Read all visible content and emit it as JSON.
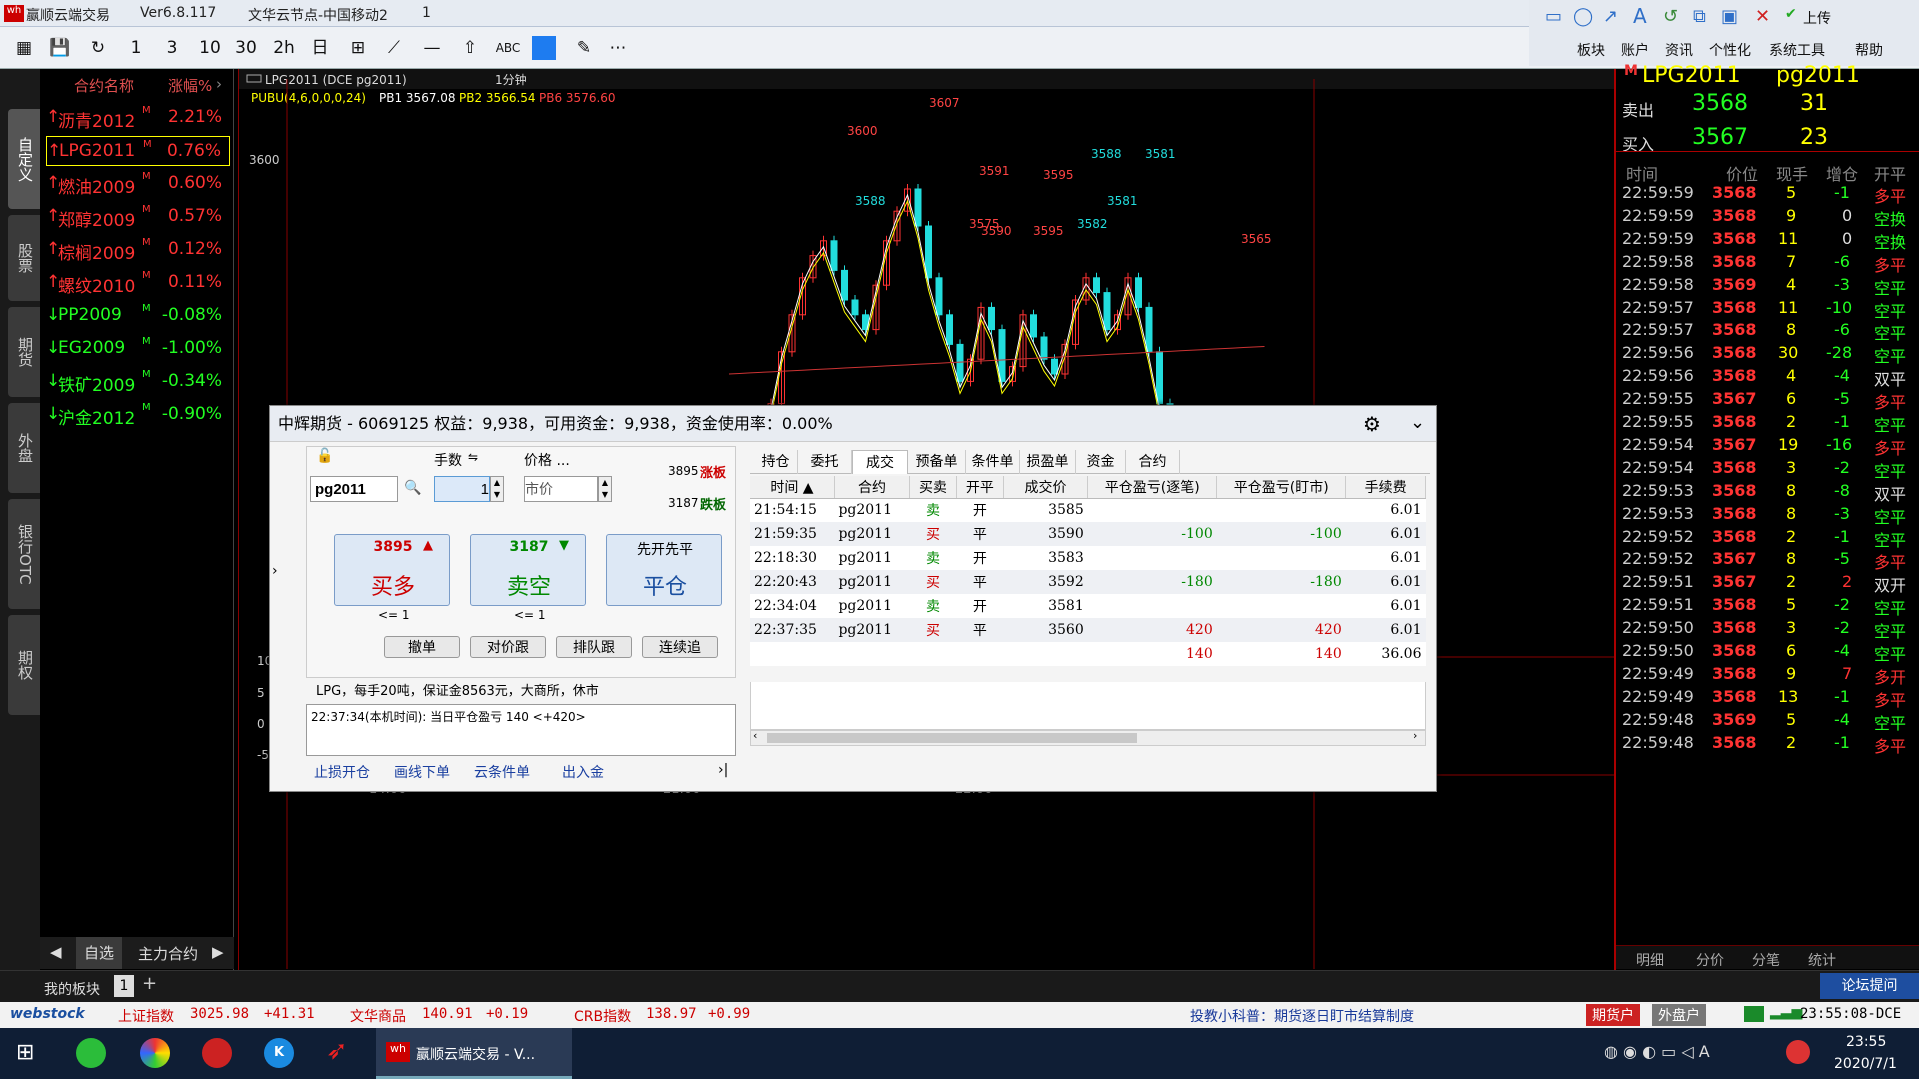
{
  "app": {
    "title": "赢顺云端交易",
    "version": "Ver6.8.117",
    "node": "文华云节点-中国移动2",
    "count": "1"
  },
  "toolbar": {
    "items": [
      "1",
      "3",
      "10",
      "30",
      "2h",
      "日",
      "⊞",
      "—",
      "⇧",
      "ABC"
    ],
    "right_menu": [
      "板块",
      "账户",
      "资讯",
      "个性化",
      "系统工具",
      "帮助"
    ],
    "upload": "上传"
  },
  "leftrail": [
    "自定义",
    "股票",
    "期货",
    "外盘",
    "银行OTC",
    "期权"
  ],
  "watchlist": {
    "col_name": "合约名称",
    "col_change": "涨幅%",
    "rows": [
      {
        "name": "沥青2012",
        "pct": "2.21%",
        "up": true
      },
      {
        "name": "LPG2011",
        "pct": "0.76%",
        "up": true
      },
      {
        "name": "燃油2009",
        "pct": "0.60%",
        "up": true
      },
      {
        "name": "郑醇2009",
        "pct": "0.57%",
        "up": true
      },
      {
        "name": "棕榈2009",
        "pct": "0.12%",
        "up": true
      },
      {
        "name": "螺纹2010",
        "pct": "0.11%",
        "up": true
      },
      {
        "name": "PP2009",
        "pct": "-0.08%",
        "up": false
      },
      {
        "name": "EG2009",
        "pct": "-1.00%",
        "up": false
      },
      {
        "name": "铁矿2009",
        "pct": "-0.34%",
        "up": false
      },
      {
        "name": "沪金2012",
        "pct": "-0.90%",
        "up": false
      }
    ],
    "foot_tabs": [
      "自选",
      "主力合约"
    ],
    "sup": "M"
  },
  "chart": {
    "symbol": "LPG2011 (DCE pg2011)",
    "period": "1分钟",
    "indicator": "PUBU(4,6,0,0,0,24)",
    "pb1": "PB1 3567.08",
    "pb2": "PB2 3566.54",
    "pb6": "PB6 3576.60",
    "price_label": "3600",
    "annotations": [
      "3607",
      "3600",
      "3588",
      "3591",
      "3590",
      "3595",
      "3595",
      "3588",
      "3581",
      "3581",
      "3582",
      "3575",
      "3565"
    ],
    "macd_axis": [
      "10",
      "5",
      "0",
      "-5"
    ],
    "time_axis": [
      "14:00",
      "21:00",
      "22:00"
    ]
  },
  "quote": {
    "market": "M",
    "name": "LPG2011",
    "code": "pg2011",
    "ask_label": "卖出",
    "ask_price": "3568",
    "ask_vol": "31",
    "bid_label": "买入",
    "bid_price": "3567",
    "bid_vol": "23",
    "headers": [
      "时间",
      "价位",
      "现手",
      "增仓",
      "开平"
    ],
    "ticks": [
      [
        "22:59:59",
        "3568",
        "5",
        "-1",
        "多平"
      ],
      [
        "22:59:59",
        "3568",
        "9",
        "0",
        "空换"
      ],
      [
        "22:59:59",
        "3568",
        "11",
        "0",
        "空换"
      ],
      [
        "22:59:58",
        "3568",
        "7",
        "-6",
        "多平"
      ],
      [
        "22:59:58",
        "3569",
        "4",
        "-3",
        "空平"
      ],
      [
        "22:59:57",
        "3568",
        "11",
        "-10",
        "空平"
      ],
      [
        "22:59:57",
        "3568",
        "8",
        "-6",
        "空平"
      ],
      [
        "22:59:56",
        "3568",
        "30",
        "-28",
        "空平"
      ],
      [
        "22:59:56",
        "3568",
        "4",
        "-4",
        "双平"
      ],
      [
        "22:59:55",
        "3567",
        "6",
        "-5",
        "多平"
      ],
      [
        "22:59:55",
        "3568",
        "2",
        "-1",
        "空平"
      ],
      [
        "22:59:54",
        "3567",
        "19",
        "-16",
        "多平"
      ],
      [
        "22:59:54",
        "3568",
        "3",
        "-2",
        "空平"
      ],
      [
        "22:59:53",
        "3568",
        "8",
        "-8",
        "双平"
      ],
      [
        "22:59:53",
        "3568",
        "8",
        "-3",
        "空平"
      ],
      [
        "22:59:52",
        "3568",
        "2",
        "-1",
        "空平"
      ],
      [
        "22:59:52",
        "3567",
        "8",
        "-5",
        "多平"
      ],
      [
        "22:59:51",
        "3567",
        "2",
        "2",
        "双开"
      ],
      [
        "22:59:51",
        "3568",
        "5",
        "-2",
        "空平"
      ],
      [
        "22:59:50",
        "3568",
        "3",
        "-2",
        "空平"
      ],
      [
        "22:59:50",
        "3568",
        "6",
        "-4",
        "空平"
      ],
      [
        "22:59:49",
        "3568",
        "9",
        "7",
        "多开"
      ],
      [
        "22:59:49",
        "3568",
        "13",
        "-1",
        "多平"
      ],
      [
        "22:59:48",
        "3569",
        "5",
        "-4",
        "空平"
      ],
      [
        "22:59:48",
        "3568",
        "2",
        "-1",
        "多平"
      ]
    ],
    "foot_tabs": [
      "明细",
      "分价",
      "分笔",
      "统计"
    ]
  },
  "dialog": {
    "title": "中辉期货 - 6069125 权益：9,938，可用资金：9,938，资金使用率：0.00%",
    "contract": "pg2011",
    "qty_label": "手数",
    "qty": "1",
    "price_label": "价格 ...",
    "price": "市价",
    "limit_up": "3895",
    "limit_up_tag": "涨板",
    "limit_down": "3187",
    "limit_down_tag": "跌板",
    "buy_price": "3895",
    "buy_label": "买多",
    "sell_price": "3187",
    "sell_label": "卖空",
    "close_top": "先开先平",
    "close_label": "平仓",
    "buy_limit": "<= 1",
    "sell_limit": "<= 1",
    "actions": [
      "撤单",
      "对价跟",
      "排队跟",
      "连续追"
    ],
    "info": "LPG，每手20吨，保证金8563元，大商所，休市",
    "log": "22:37:34(本机时间): 当日平仓盈亏 140 <+420>",
    "links": [
      "止损开仓",
      "画线下单",
      "云条件单",
      "出入金"
    ],
    "tabs": [
      "持仓",
      "委托",
      "成交",
      "预备单",
      "条件单",
      "损盈单",
      "资金",
      "合约"
    ],
    "headers": [
      "时间 ▲",
      "合约",
      "买卖",
      "开平",
      "成交价",
      "平仓盈亏(逐笔)",
      "平仓盈亏(盯市)",
      "手续费"
    ],
    "rows": [
      [
        "21:54:15",
        "pg2011",
        "卖",
        "开",
        "3585",
        "",
        "",
        "6.01"
      ],
      [
        "21:59:35",
        "pg2011",
        "买",
        "平",
        "3590",
        "-100",
        "-100",
        "6.01"
      ],
      [
        "22:18:30",
        "pg2011",
        "卖",
        "开",
        "3583",
        "",
        "",
        "6.01"
      ],
      [
        "22:20:43",
        "pg2011",
        "买",
        "平",
        "3592",
        "-180",
        "-180",
        "6.01"
      ],
      [
        "22:34:04",
        "pg2011",
        "卖",
        "开",
        "3581",
        "",
        "",
        "6.01"
      ],
      [
        "22:37:35",
        "pg2011",
        "买",
        "平",
        "3560",
        "420",
        "420",
        "6.01"
      ],
      [
        "",
        "",
        "",
        "",
        "",
        "140",
        "140",
        "36.06"
      ]
    ]
  },
  "board": {
    "label": "我的板块",
    "tab": "1",
    "add": "+",
    "forum": "论坛提问"
  },
  "ticker": {
    "brand": "webstock",
    "items": [
      {
        "n": "上证指数",
        "v": "3025.98",
        "c": "+41.31"
      },
      {
        "n": "文华商品",
        "v": "140.91",
        "c": "+0.19"
      },
      {
        "n": "CRB指数",
        "v": "138.97",
        "c": "+0.99"
      }
    ],
    "news": "投教小科普：期货逐日盯市结算制度",
    "acct1": "期货户",
    "acct2": "外盘户",
    "clock": "23:55:08-DCE"
  },
  "taskbar": {
    "app_label": "赢顺云端交易 - V...",
    "time": "23:55",
    "date": "2020/7/1"
  }
}
